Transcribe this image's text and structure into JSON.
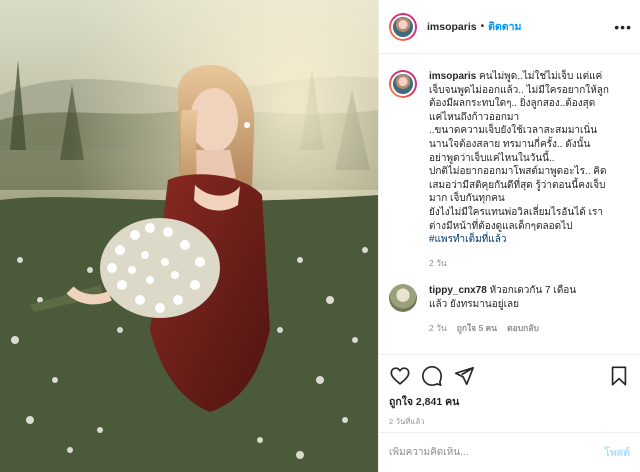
{
  "post": {
    "username": "imsoparis",
    "follow_label": "ติดตาม",
    "dot": "•",
    "more_label": "•••",
    "caption_lines": [
      "คนไม่พูด..ไม่ใช่ไม่เจ็บ แต่แค่",
      "เจ็บจนพูดไม่ออกแล้ว.. ไม่มีใครอยากให้ลูก",
      "ต้องมีผลกระทบใดๆ.. ยิ่งลูกสอง..ต้องสุด",
      "แค่ไหนถึงก้าวออกมา",
      "..ขนาดความเจ็บยังใช้เวลาสะสมมาเนิ่น",
      "นานใจต้องสลาย ทรมานกี่ครั้ง.. ดังนั้น",
      "อย่าพูดว่าเจ็บแค่ไหนในวันนี้..",
      "ปกติไม่อยากออกมาโพสต์มาพูดอะไร.. คิด",
      "เสมอว่ามีสติคุยกันดีที่สุด รู้ว่าตอนนี้คงเจ็บ",
      "มาก เจ็บกันทุกคน",
      "ยังไงไม่มีใครแทนพ่อวิลเลี่ยมไรอันได้ เรา",
      "ต่างมีหน้าที่ต้องดูแลเด็กๆตลอดไป"
    ],
    "hashtag": "#แพรทำเต็มที่แล้ว",
    "caption_time": "2 วัน",
    "comment": {
      "username": "tippy_cnx78",
      "text_line1": "หัวอกเดวกัน 7 เดือน",
      "text_line2": "แล้ว ยังทรมานอยู่เลย",
      "time": "2 วัน",
      "likes": "ถูกใจ 5 คน",
      "reply": "ตอบกลับ",
      "heart": "♡"
    },
    "likes_text": "ถูกใจ 2,841 คน",
    "posted_ago": "2 วันที่แล้ว",
    "comment_placeholder": "เพิ่มความคิดเห็น...",
    "post_button": "โพสต์",
    "colors": {
      "link_blue": "#0095f6",
      "hashtag": "#00376b",
      "muted": "#8e8e8e",
      "post_disabled": "#b2dffc"
    },
    "icons": [
      "heart-icon",
      "comment-icon",
      "share-icon",
      "bookmark-icon"
    ]
  }
}
